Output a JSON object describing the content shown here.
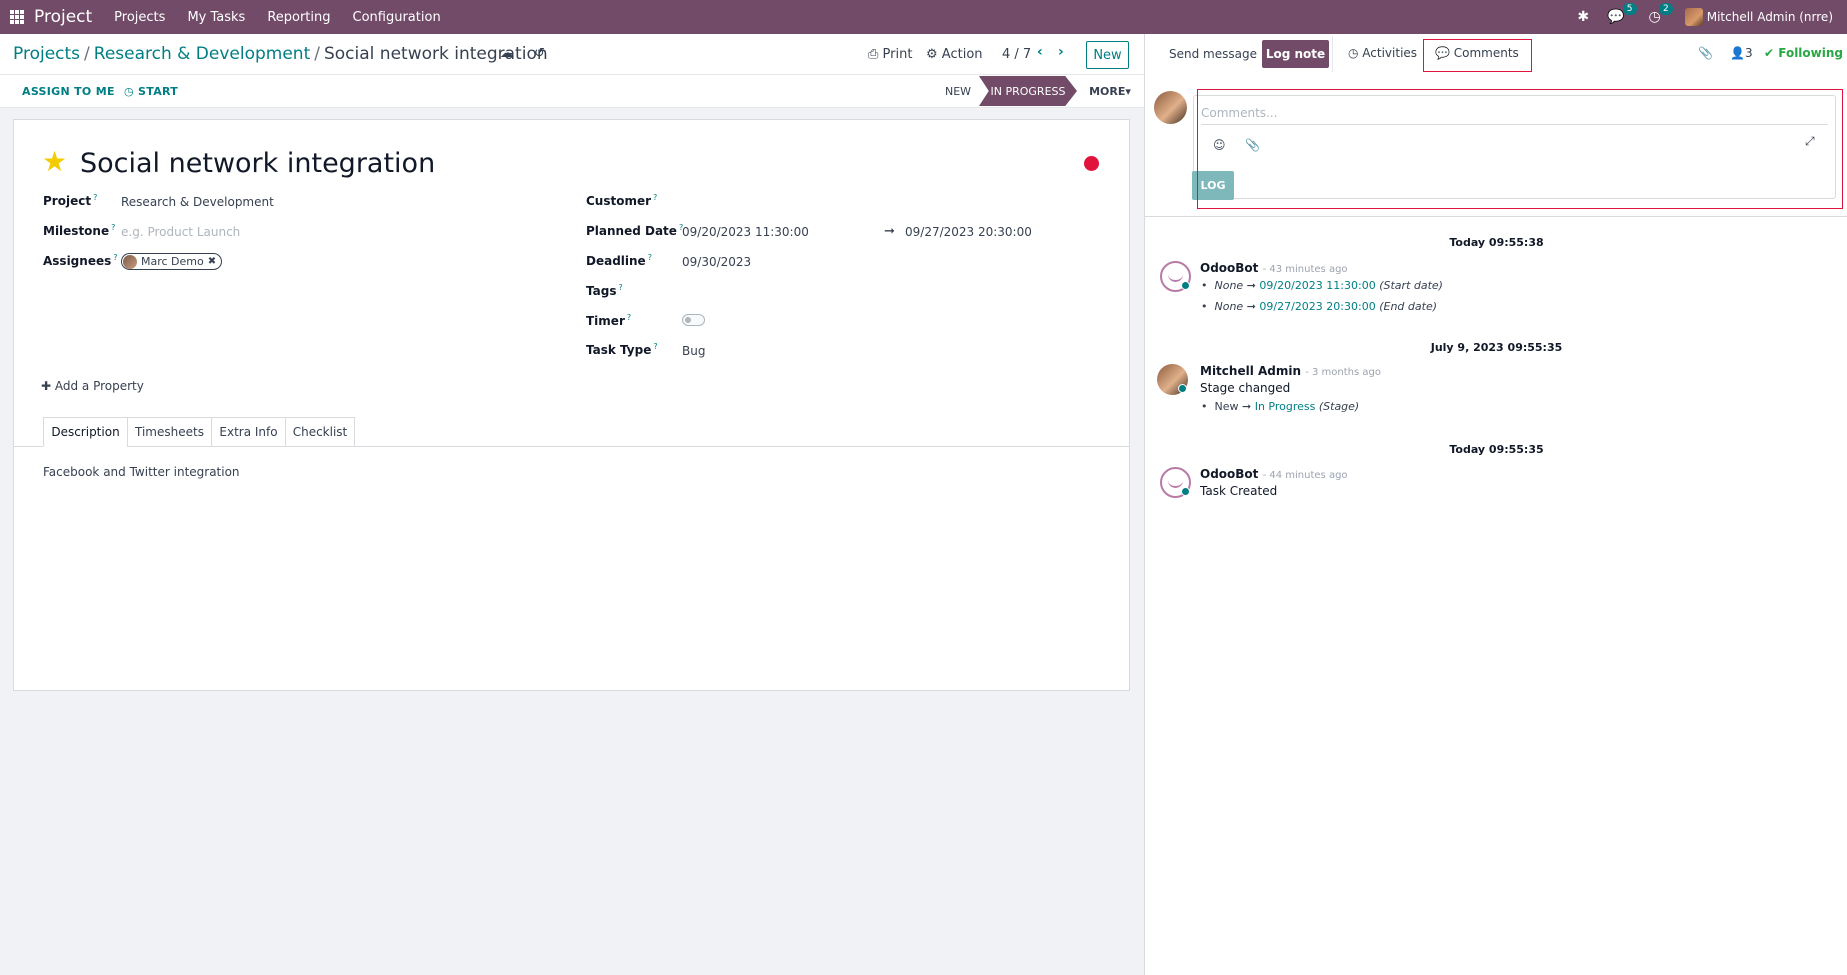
{
  "navbar": {
    "brand": "Project",
    "menu": [
      "Projects",
      "My Tasks",
      "Reporting",
      "Configuration"
    ],
    "messages_count": "5",
    "activities_count": "2",
    "user": "Mitchell Admin (nrre)"
  },
  "breadcrumb": {
    "root": "Projects",
    "project": "Research & Development",
    "current": "Social network integration"
  },
  "control": {
    "print": "Print",
    "action": "Action",
    "pager": "4 / 7",
    "new": "New"
  },
  "statusbar": {
    "assign": "ASSIGN TO ME",
    "start": "START",
    "stages": [
      "NEW",
      "IN PROGRESS"
    ],
    "more": "MORE"
  },
  "task": {
    "title": "Social network integration",
    "project_label": "Project",
    "project": "Research & Development",
    "milestone_label": "Milestone",
    "milestone_placeholder": "e.g. Product Launch",
    "assignees_label": "Assignees",
    "assignee": "Marc Demo",
    "customer_label": "Customer",
    "planned_label": "Planned Date",
    "planned_start": "09/20/2023 11:30:00",
    "planned_end": "09/27/2023 20:30:00",
    "deadline_label": "Deadline",
    "deadline": "09/30/2023",
    "tags_label": "Tags",
    "timer_label": "Timer",
    "task_type_label": "Task Type",
    "task_type": "Bug",
    "add_property": "Add a Property",
    "tabs": [
      "Description",
      "Timesheets",
      "Extra Info",
      "Checklist"
    ],
    "description": "Facebook and Twitter integration"
  },
  "chatter": {
    "send_message": "Send message",
    "log_note": "Log note",
    "activities": "Activities",
    "comments": "Comments",
    "attachments_count": "",
    "followers_count": "3",
    "following": "Following",
    "composer_placeholder": "Comments...",
    "log_button": "LOG",
    "messages": [
      {
        "date": "Today 09:55:38",
        "author": "OdooBot",
        "ago": "- 43 minutes ago",
        "changes": [
          {
            "old": "None",
            "new": "09/20/2023 11:30:00",
            "field": "(Start date)"
          },
          {
            "old": "None",
            "new": "09/27/2023 20:30:00",
            "field": "(End date)"
          }
        ]
      },
      {
        "date": "July 9, 2023 09:55:35",
        "author": "Mitchell Admin",
        "ago": "- 3 months ago",
        "text": "Stage changed",
        "changes": [
          {
            "old": "New",
            "new": "In Progress",
            "field": "(Stage)"
          }
        ]
      },
      {
        "date": "Today 09:55:35",
        "author": "OdooBot",
        "ago": "- 44 minutes ago",
        "text": "Task Created"
      }
    ]
  },
  "colors": {
    "brand": "#714b67",
    "accent": "#017e84",
    "highlight": "#e0143c",
    "star": "#f3cc00"
  }
}
